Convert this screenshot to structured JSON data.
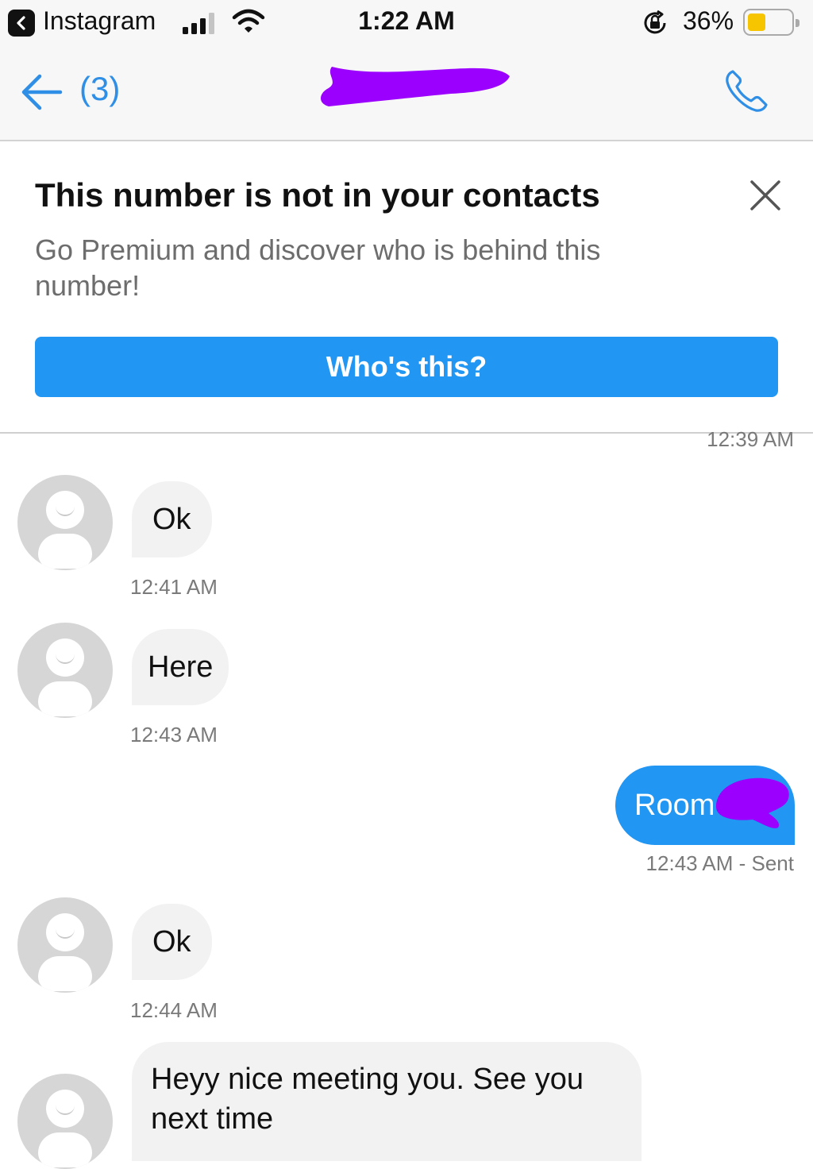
{
  "status_bar": {
    "back_app": "Instagram",
    "time": "1:22 AM",
    "battery_pct": "36%",
    "icons": [
      "back-to-app-icon",
      "cell-signal-icon",
      "wifi-icon",
      "orientation-lock-icon",
      "battery-icon"
    ]
  },
  "nav": {
    "back_icon": "arrow-left-icon",
    "unread_count": "(3)",
    "call_icon": "phone-icon",
    "title_redacted": true
  },
  "banner": {
    "title": "This number is not in your contacts",
    "subtitle": "Go Premium and discover who is behind this number!",
    "button_label": "Who's this?",
    "close_icon": "close-icon"
  },
  "messages": [
    {
      "direction": "in",
      "text": "",
      "time": "12:39 AM"
    },
    {
      "direction": "in",
      "text": "Ok",
      "time": "12:41 AM"
    },
    {
      "direction": "in",
      "text": "Here",
      "time": "12:43 AM"
    },
    {
      "direction": "out",
      "text": "Room",
      "time": "12:43 AM - Sent"
    },
    {
      "direction": "in",
      "text": "Ok",
      "time": "12:44 AM"
    },
    {
      "direction": "in",
      "text": "Heyy nice meeting you. See you next time",
      "time": ""
    }
  ],
  "colors": {
    "accent": "#2196f3",
    "link_blue": "#2f8fe6",
    "bubble_in": "#f2f2f2",
    "redaction": "#9b00ff",
    "battery_fill": "#f6c500"
  }
}
